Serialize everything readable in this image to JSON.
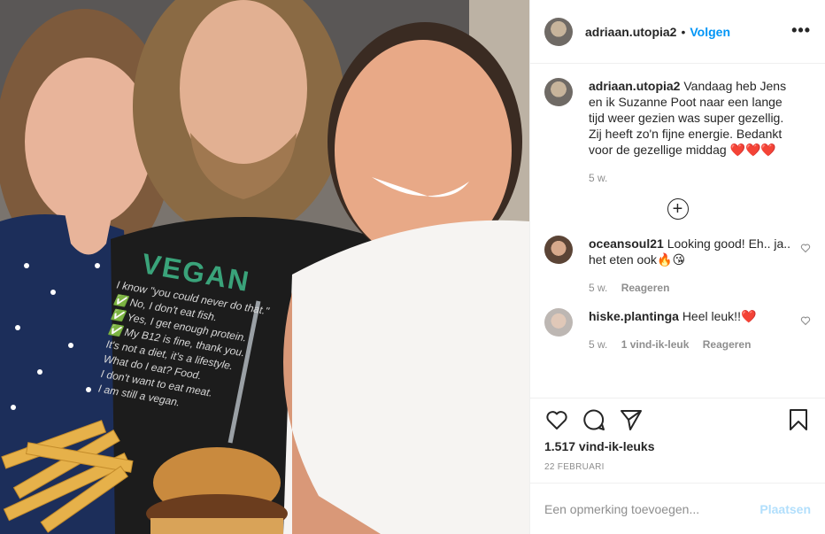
{
  "post": {
    "username": "adriaan.utopia2",
    "separator": "•",
    "follow_label": "Volgen",
    "more_label": "•••",
    "caption": {
      "username": "adriaan.utopia2",
      "text": "Vandaag heb Jens en ik Suzanne Poot naar een lange tijd weer gezien was super gezellig. Zij heeft zo'n fijne energie. Bedankt voor de gezellige middag ❤️❤️❤️",
      "time": "5 w."
    },
    "comments": [
      {
        "username": "oceansoul21",
        "text": "Looking good! Eh.. ja.. het eten ook🔥😘",
        "time": "5 w.",
        "likes": "",
        "reply_label": "Reageren"
      },
      {
        "username": "hiske.plantinga",
        "text": "Heel leuk!!❤️",
        "time": "5 w.",
        "likes": "1 vind-ik-leuk",
        "reply_label": "Reageren"
      }
    ],
    "load_more_label": "+",
    "likes_count": "1.517 vind-ik-leuks",
    "date": "22 FEBRUARI",
    "comment_placeholder": "Een opmerking toevoegen...",
    "post_label": "Plaatsen"
  },
  "photo": {
    "shirt_title": "VEGAN",
    "shirt_lines": [
      "I know \"you could never do that.\"",
      "✅ No, I don't eat fish.",
      "✅ Yes, I get enough protein.",
      "✅ My B12 is fine, thank you.",
      "It's not a diet, it's a lifestyle.",
      "What do I eat? Food.",
      "I don't want to eat meat.",
      "I am still a vegan."
    ]
  },
  "colors": {
    "accent": "#0095f6",
    "post_disabled": "#b2dffc",
    "muted": "#8e8e8e",
    "heart_red": "#ed4956"
  },
  "icons": {
    "like": "heart-outline-icon",
    "comment": "comment-bubble-icon",
    "share": "paper-plane-icon",
    "save": "bookmark-icon",
    "more": "ellipsis-icon",
    "comment_like": "heart-small-icon"
  }
}
